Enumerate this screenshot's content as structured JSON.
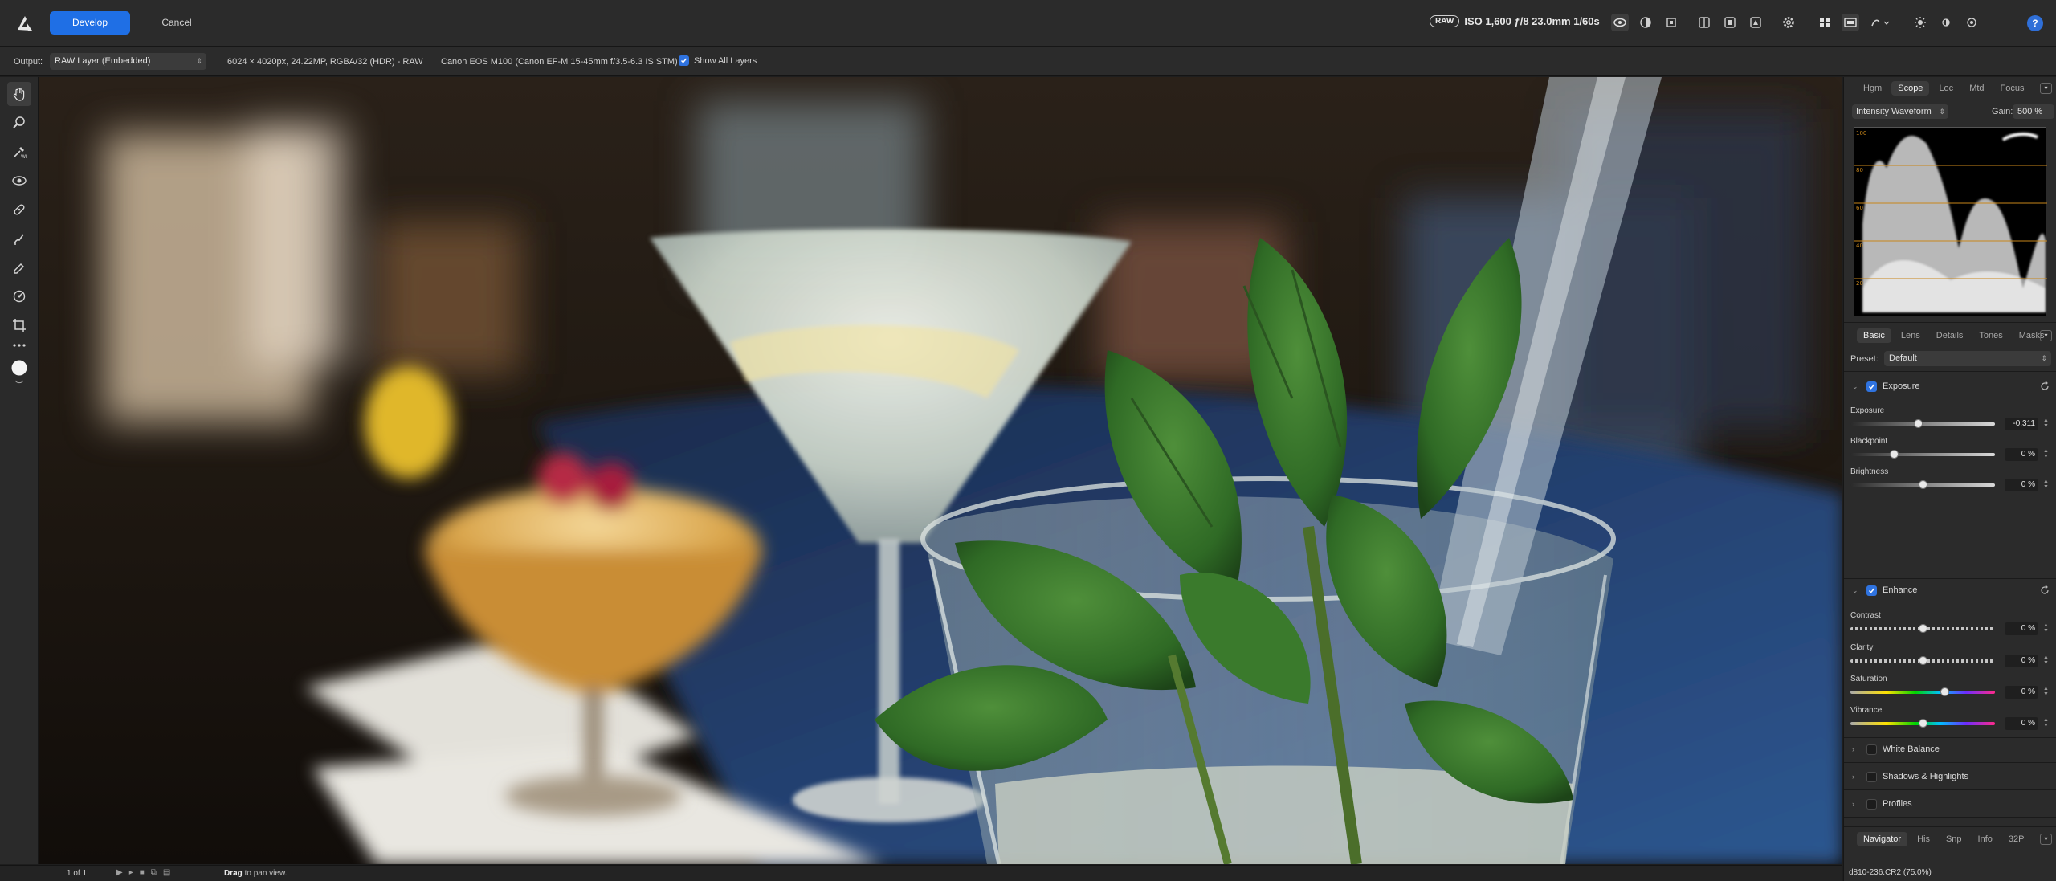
{
  "topbar": {
    "develop_label": "Develop",
    "cancel_label": "Cancel",
    "raw_badge": "RAW",
    "exif": "ISO 1,600 ƒ/8 23.0mm 1/60s",
    "help_label": "?"
  },
  "context": {
    "output_label": "Output:",
    "output_value": "RAW Layer (Embedded)",
    "image_info": "6024 × 4020px, 24.22MP, RGBA/32 (HDR) - RAW",
    "camera_info": "Canon EOS M100 (Canon EF-M 15-45mm f/3.5-6.3 IS STM)",
    "show_all_layers": "Show All Layers"
  },
  "scope_tabs": [
    {
      "label": "Hgm",
      "active": false
    },
    {
      "label": "Scope",
      "active": true
    },
    {
      "label": "Loc",
      "active": false
    },
    {
      "label": "Mtd",
      "active": false
    },
    {
      "label": "Focus",
      "active": false
    }
  ],
  "scope": {
    "mode": "Intensity Waveform",
    "gain_label": "Gain:",
    "gain_value": "500 %",
    "scale_labels": [
      "100",
      "80",
      "60",
      "40",
      "20"
    ]
  },
  "adjust_tabs": [
    {
      "label": "Basic",
      "active": true
    },
    {
      "label": "Lens",
      "active": false
    },
    {
      "label": "Details",
      "active": false
    },
    {
      "label": "Tones",
      "active": false
    },
    {
      "label": "Masks",
      "active": false
    }
  ],
  "preset": {
    "label": "Preset:",
    "value": "Default"
  },
  "sections": {
    "exposure": "Exposure",
    "enhance": "Enhance",
    "white_balance": "White Balance",
    "shadows_highlights": "Shadows & Highlights",
    "profiles": "Profiles"
  },
  "sliders": [
    {
      "key": "exposure",
      "label": "Exposure",
      "value": "-0.311",
      "position": 0.47,
      "style": "grey"
    },
    {
      "key": "blackpoint",
      "label": "Blackpoint",
      "value": "0 %",
      "position": 0.3,
      "style": "grey"
    },
    {
      "key": "brightness",
      "label": "Brightness",
      "value": "0 %",
      "position": 0.5,
      "style": "grey"
    },
    {
      "key": "contrast",
      "label": "Contrast",
      "value": "0 %",
      "position": 0.5,
      "style": "dashed"
    },
    {
      "key": "clarity",
      "label": "Clarity",
      "value": "0 %",
      "position": 0.5,
      "style": "dashed"
    },
    {
      "key": "saturation",
      "label": "Saturation",
      "value": "0 %",
      "position": 0.65,
      "style": "spectrum"
    },
    {
      "key": "vibrance",
      "label": "Vibrance",
      "value": "0 %",
      "position": 0.5,
      "style": "spectrum"
    }
  ],
  "nav_tabs": [
    {
      "label": "Navigator",
      "active": true
    },
    {
      "label": "His",
      "active": false
    },
    {
      "label": "Snp",
      "active": false
    },
    {
      "label": "Info",
      "active": false
    },
    {
      "label": "32P",
      "active": false
    }
  ],
  "status": {
    "pages": "1 of 1",
    "hint_bold": "Drag",
    "hint_rest": " to pan view.",
    "file": "d810-236.CR2 (75.0%)"
  },
  "colors": {
    "accent": "#1f6fe5",
    "waveform_guides": "#c8861a"
  }
}
